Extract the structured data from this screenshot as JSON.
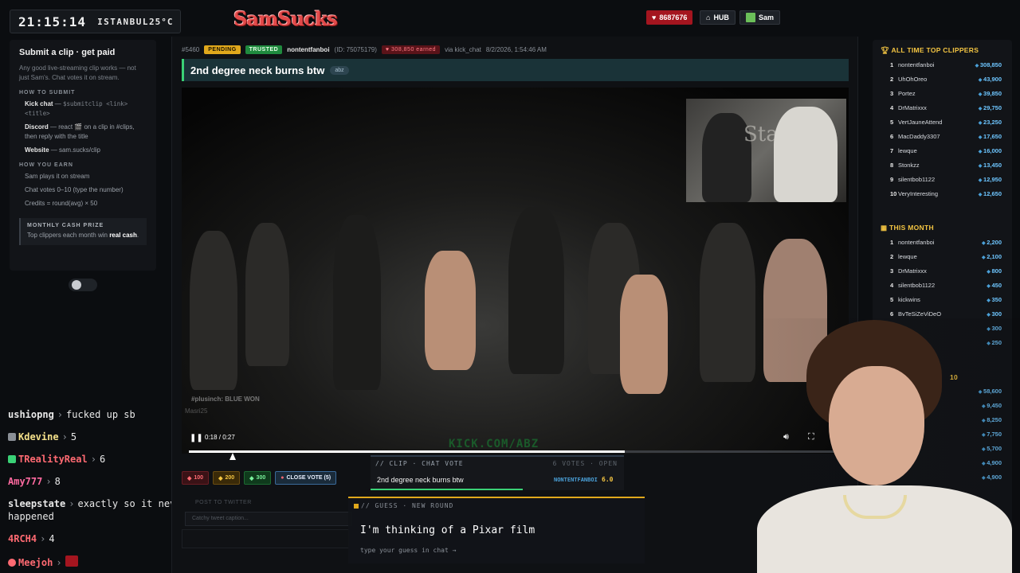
{
  "header": {
    "time": "21:15:14",
    "city": "ISTANBUL",
    "temp": "25°C",
    "logo": "SamSucks",
    "gem_count": "8687676",
    "hub": "HUB",
    "user": "Sam"
  },
  "left_panel": {
    "title": "Submit a clip · get paid",
    "intro": "Any good live-streaming clip works — not just Sam's. Chat votes it on stream.",
    "how_submit_label": "HOW TO SUBMIT",
    "submit_methods": [
      {
        "name": "Kick chat",
        "sep": " — ",
        "detail": "$submitclip <link> <title>"
      },
      {
        "name": "Discord",
        "sep": " — ",
        "detail": "react 🎬 on a clip in #clips, then reply with the title"
      },
      {
        "name": "Website",
        "sep": " — ",
        "detail": "sam.sucks/clip"
      }
    ],
    "how_earn_label": "HOW YOU EARN",
    "earn_items": [
      "Sam plays it on stream",
      "Chat votes 0–10 (type the number)",
      "Credits = round(avg) × 50"
    ],
    "prize_title": "MONTHLY CASH PRIZE",
    "prize_text": "Top clippers each month win",
    "prize_bold": "real cash",
    "prize_end": "."
  },
  "chat": [
    {
      "user": "ushiopng",
      "color": "#e8e8e8",
      "msg": "fucked up sb",
      "badge": ""
    },
    {
      "user": "Kdevine",
      "color": "#f4e08a",
      "msg": "5",
      "badge": "#8a8f96"
    },
    {
      "user": "TRealityReal",
      "color": "#ff6a72",
      "msg": "6",
      "badge": "#3ad176"
    },
    {
      "user": "Amy777",
      "color": "#ff6aa0",
      "msg": "8",
      "badge": ""
    },
    {
      "user": "sleepstate",
      "color": "#e8e8e8",
      "msg": "exactly so it never",
      "badge": ""
    },
    {
      "user": "",
      "color": "#e8e8e8",
      "msg": "happened",
      "badge": ""
    },
    {
      "user": "4RCH4",
      "color": "#ff6a72",
      "msg": "4",
      "badge": ""
    },
    {
      "user": "Meejoh",
      "color": "#ff6a72",
      "msg": "",
      "badge": "#a4151f"
    }
  ],
  "clip": {
    "id": "#5460",
    "status": "PENDING",
    "trust": "TRUSTED",
    "submitter": "nontentfanboi",
    "submitter_id": "(ID: 75075179)",
    "earned": "308,850 earned",
    "via": "via kick_chat",
    "date": "8/2/2026, 1:54:46 AM",
    "title": "2nd degree neck burns btw",
    "tag": "abz"
  },
  "video": {
    "time": "0:18 / 0:27",
    "progress": 0.667,
    "watermark": "KICK.COM/ABZ",
    "overlay_text_1": "#plusinch: BLUE WON",
    "overlay_text_2": "Masri25",
    "inset_brand": "Stake"
  },
  "vote_buttons": [
    {
      "label": "100",
      "style": "vb-red"
    },
    {
      "label": "200",
      "style": "vb-gold"
    },
    {
      "label": "300",
      "style": "vb-green"
    }
  ],
  "close_vote": "CLOSE VOTE (5)",
  "post_label": "POST TO TWITTER",
  "caption_placeholder": "Catchy tweet caption...",
  "chat_vote_overlay": {
    "head": "// CLIP · CHAT VOTE",
    "votes": "6 VOTES · OPEN",
    "title": "2nd degree neck burns btw",
    "user": "NONTENTFANBOI",
    "score": "6.0",
    "progress": 0.6
  },
  "guess_overlay": {
    "head": "// GUESS · NEW ROUND",
    "main": "I'm thinking of a Pixar film",
    "hint": "type your guess in chat →"
  },
  "leaderboards": {
    "all_time_title": "ALL TIME TOP CLIPPERS",
    "all_time": [
      {
        "rank": "1",
        "name": "nontentfanboi",
        "value": "308,850"
      },
      {
        "rank": "2",
        "name": "UhOhOreo",
        "value": "43,900"
      },
      {
        "rank": "3",
        "name": "Portez",
        "value": "39,850"
      },
      {
        "rank": "4",
        "name": "DrMatrixxx",
        "value": "29,750"
      },
      {
        "rank": "5",
        "name": "VertJauneAttend",
        "value": "23,250"
      },
      {
        "rank": "6",
        "name": "MacDaddy3307",
        "value": "17,650"
      },
      {
        "rank": "7",
        "name": "lewque",
        "value": "16,000"
      },
      {
        "rank": "8",
        "name": "Stonkzz",
        "value": "13,450"
      },
      {
        "rank": "9",
        "name": "silentbob1122",
        "value": "12,950"
      },
      {
        "rank": "10",
        "name": "VeryInteresting",
        "value": "12,650"
      }
    ],
    "month_title": "THIS MONTH",
    "month": [
      {
        "rank": "1",
        "name": "nontentfanboi",
        "value": "2,200"
      },
      {
        "rank": "2",
        "name": "lewque",
        "value": "2,100"
      },
      {
        "rank": "3",
        "name": "DrMatrixxx",
        "value": "800"
      },
      {
        "rank": "4",
        "name": "silentbob1122",
        "value": "450"
      },
      {
        "rank": "5",
        "name": "kickwins",
        "value": "350"
      },
      {
        "rank": "6",
        "name": "BvTeSiZeViDeO",
        "value": "300"
      },
      {
        "rank": "",
        "name": "",
        "value": "300"
      },
      {
        "rank": "",
        "name": "",
        "value": "250"
      }
    ],
    "third_title": "10",
    "third": [
      "58,600",
      "9,450",
      "8,250",
      "7,750",
      "5,700",
      "4,900",
      "4,900"
    ]
  }
}
